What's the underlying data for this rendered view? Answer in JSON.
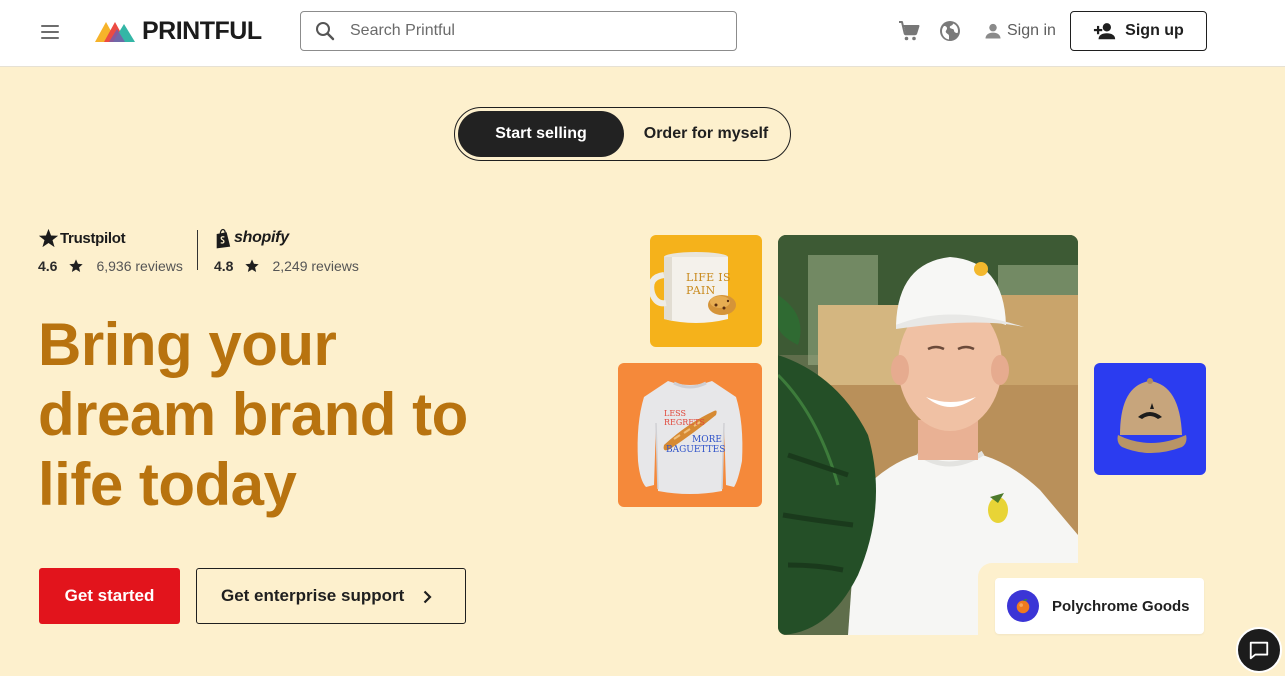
{
  "header": {
    "logo_text": "PRINTFUL",
    "search_placeholder": "Search Printful",
    "signin_label": "Sign in",
    "signup_label": "Sign up",
    "icons": [
      "menu-icon",
      "search-icon",
      "cart-icon",
      "globe-icon",
      "person-icon",
      "add-person-icon"
    ]
  },
  "toggle": {
    "active_label": "Start selling",
    "inactive_label": "Order for myself"
  },
  "ratings": {
    "trustpilot": {
      "brand": "Trustpilot",
      "score": "4.6",
      "reviews": "6,936 reviews"
    },
    "shopify": {
      "brand": "shopify",
      "score": "4.8",
      "reviews": "2,249 reviews"
    }
  },
  "hero": {
    "headline_line1": "Bring your",
    "headline_line2": "dream brand to",
    "headline_line3": "life today",
    "primary_cta": "Get started",
    "secondary_cta": "Get enterprise support"
  },
  "products": {
    "mug_text_1": "LIFE IS PAIN",
    "sweatshirt_text_1": "LESS REGRETS",
    "sweatshirt_text_2": "MORE BAGUETTES",
    "brand_card_name": "Polychrome Goods"
  },
  "colors": {
    "background": "#fdf0cd",
    "headline": "#b8730f",
    "primary_cta": "#e2141c",
    "mug_tile": "#f5b21b",
    "sweatshirt_tile": "#f5893a",
    "cap_tile": "#2b3cf0"
  }
}
